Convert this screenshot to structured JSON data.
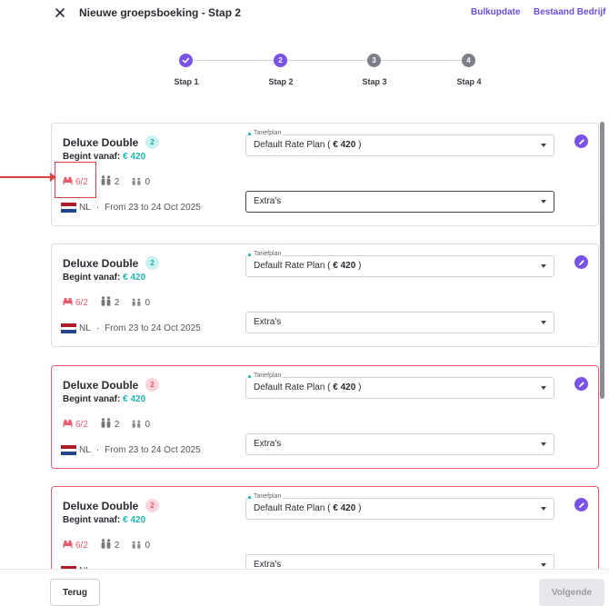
{
  "header": {
    "title": "Nieuwe groepsboeking - Stap 2",
    "bulk_update": "Bulkupdate",
    "existing_company": "Bestaand Bedrijf"
  },
  "stepper": {
    "steps": [
      {
        "label": "Stap 1",
        "number": "",
        "state": "done"
      },
      {
        "label": "Stap 2",
        "number": "2",
        "state": "current"
      },
      {
        "label": "Stap 3",
        "number": "3",
        "state": "pending"
      },
      {
        "label": "Stap 4",
        "number": "4",
        "state": "pending"
      }
    ]
  },
  "rooms": [
    {
      "title": "Deluxe Double",
      "count": "2",
      "valid": true,
      "price_prefix": "Begint vanaf:",
      "price": "€ 420",
      "beds": "6/2",
      "adults": "2",
      "children": "0",
      "country": "NL",
      "dates": "From 23 to 24 Oct 2025",
      "rate_legend": "Tariefplan",
      "rate_name": "Default Rate Plan (",
      "rate_price": "€ 420",
      "rate_close": ")",
      "extras": "Extra's"
    },
    {
      "title": "Deluxe Double",
      "count": "2",
      "valid": true,
      "price_prefix": "Begint vanaf:",
      "price": "€ 420",
      "beds": "6/2",
      "adults": "2",
      "children": "0",
      "country": "NL",
      "dates": "From 23 to 24 Oct 2025",
      "rate_legend": "Tariefplan",
      "rate_name": "Default Rate Plan (",
      "rate_price": "€ 420",
      "rate_close": ")",
      "extras": "Extra's"
    },
    {
      "title": "Deluxe Double",
      "count": "2",
      "valid": false,
      "price_prefix": "Begint vanaf:",
      "price": "€ 420",
      "beds": "6/2",
      "adults": "2",
      "children": "0",
      "country": "NL",
      "dates": "From 23 to 24 Oct 2025",
      "rate_legend": "Tariefplan",
      "rate_name": "Default Rate Plan (",
      "rate_price": "€ 420",
      "rate_close": ")",
      "extras": "Extra's"
    },
    {
      "title": "Deluxe Double",
      "count": "2",
      "valid": false,
      "price_prefix": "Begint vanaf:",
      "price": "€ 420",
      "beds": "6/2",
      "adults": "2",
      "children": "0",
      "country": "NL",
      "dates": "",
      "rate_legend": "Tariefplan",
      "rate_name": "Default Rate Plan (",
      "rate_price": "€ 420",
      "rate_close": ")",
      "extras": "Extra's"
    }
  ],
  "footer": {
    "back": "Terug",
    "next": "Volgende"
  },
  "colors": {
    "accent": "#7a52e6",
    "price": "#20b5b2",
    "error": "#e8596e",
    "annotation": "#d94040"
  }
}
